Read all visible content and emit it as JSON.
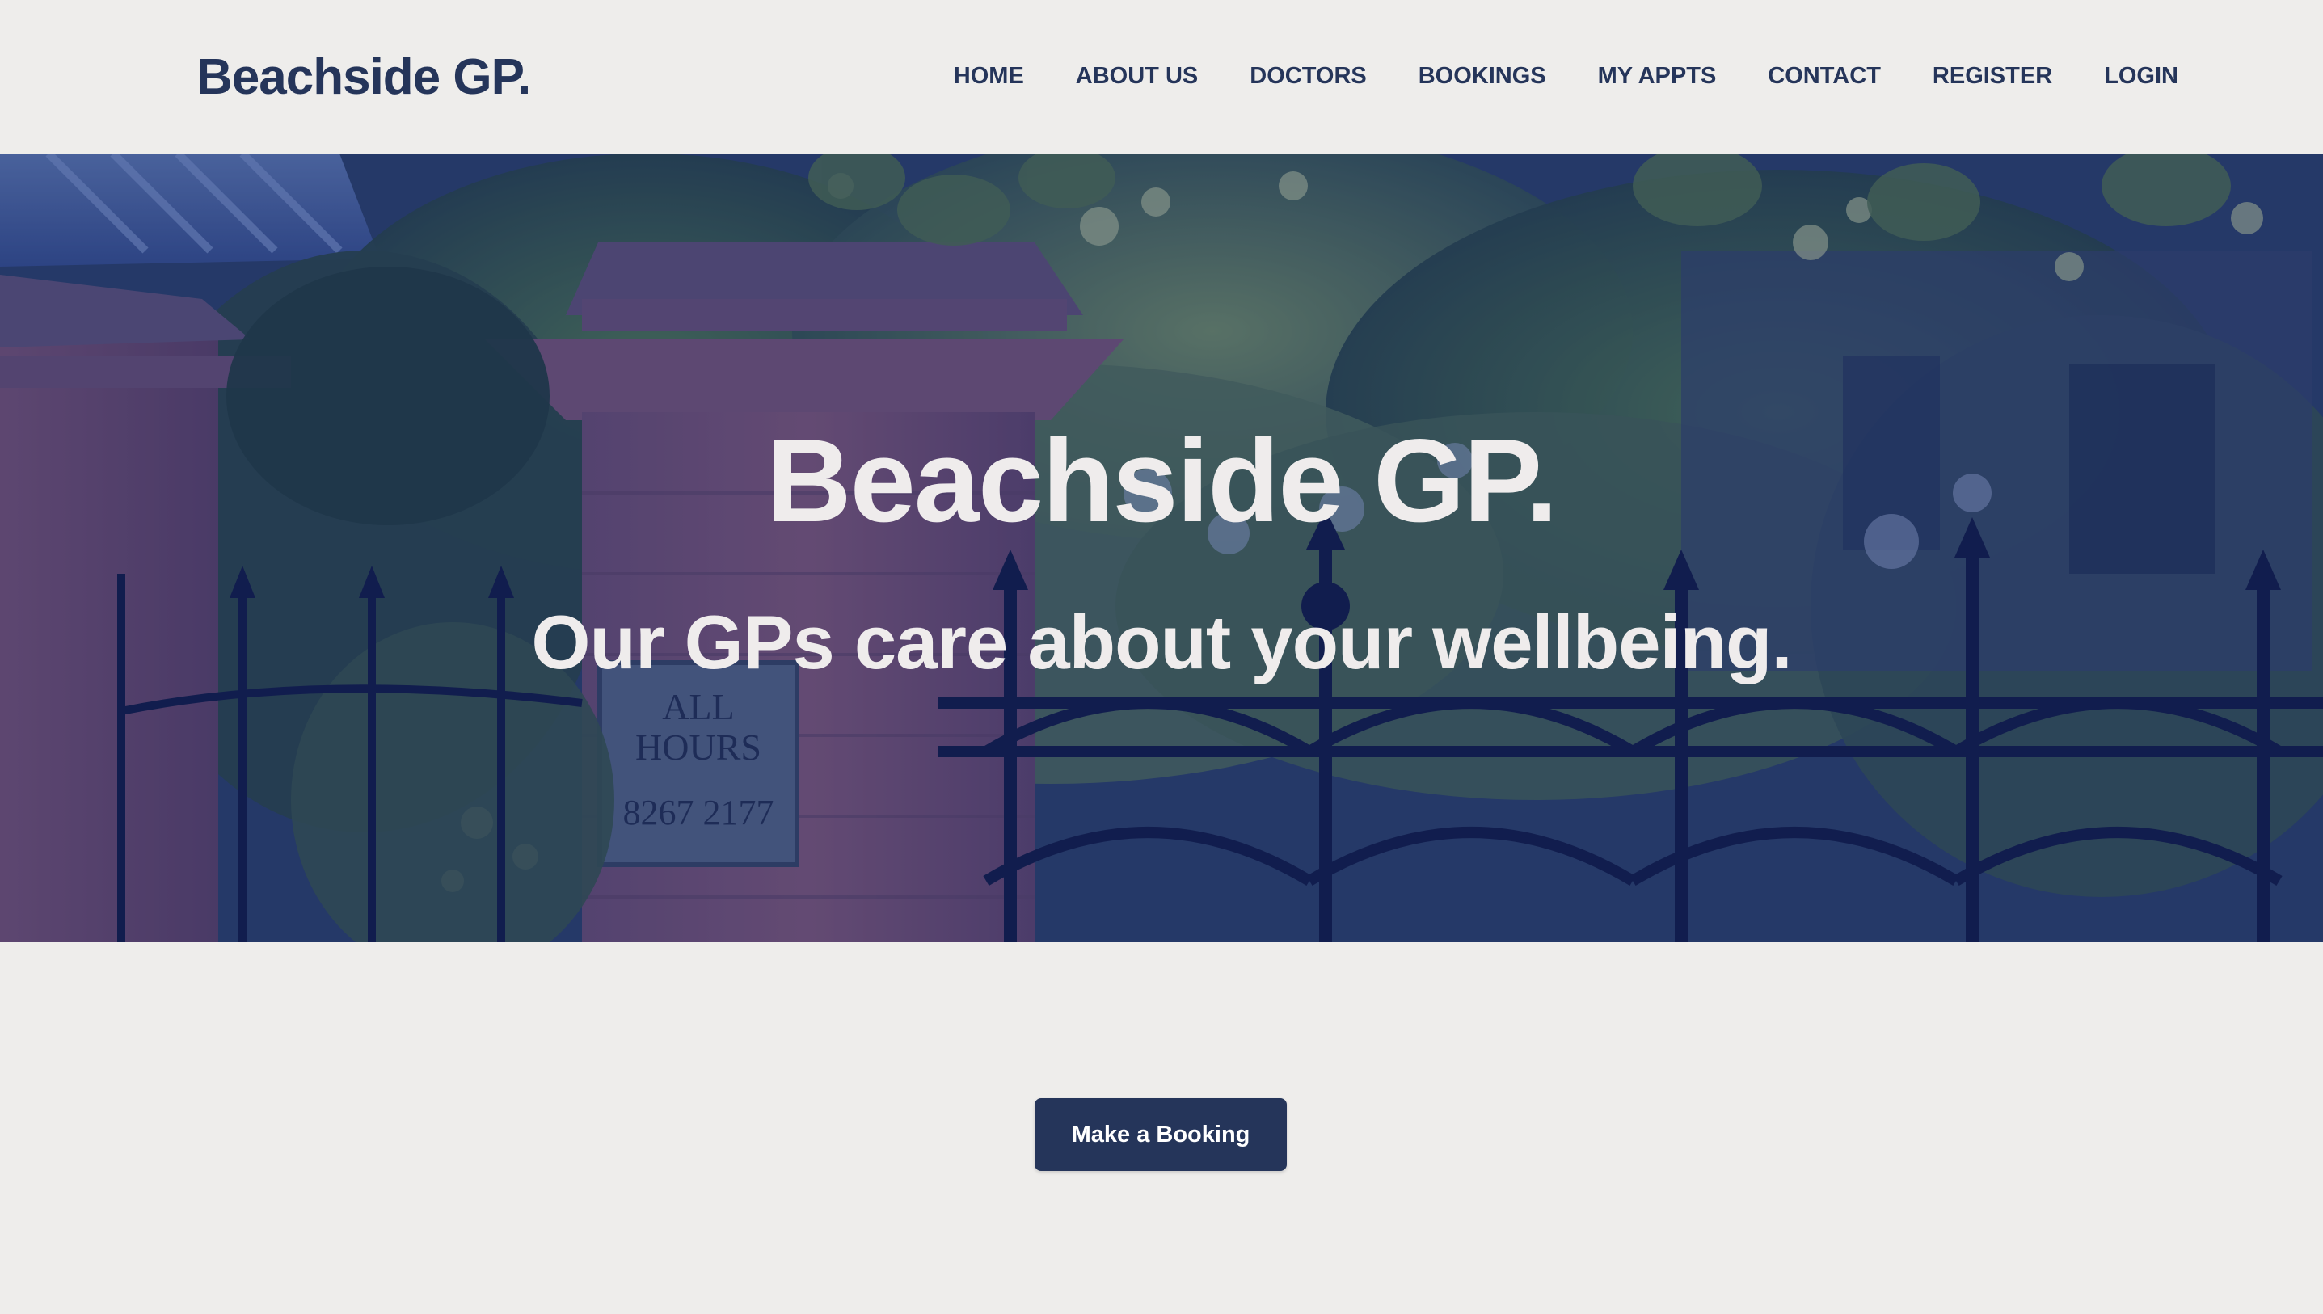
{
  "brand": {
    "logo_text": "Beachside GP.",
    "primary_color": "#25355a",
    "background_color": "#eeedeb"
  },
  "nav": {
    "items": [
      {
        "label": "HOME"
      },
      {
        "label": "ABOUT US"
      },
      {
        "label": "DOCTORS"
      },
      {
        "label": "BOOKINGS"
      },
      {
        "label": "MY APPTS"
      },
      {
        "label": "CONTACT"
      },
      {
        "label": "REGISTER"
      },
      {
        "label": "LOGIN"
      }
    ]
  },
  "hero": {
    "title": "Beachside GP.",
    "subtitle": "Our GPs care about your wellbeing.",
    "image_sign_lines": [
      "ALL",
      "HOURS",
      "8267 2177"
    ],
    "overlay_color": "#16286e"
  },
  "cta": {
    "booking_label": "Make a Booking"
  }
}
